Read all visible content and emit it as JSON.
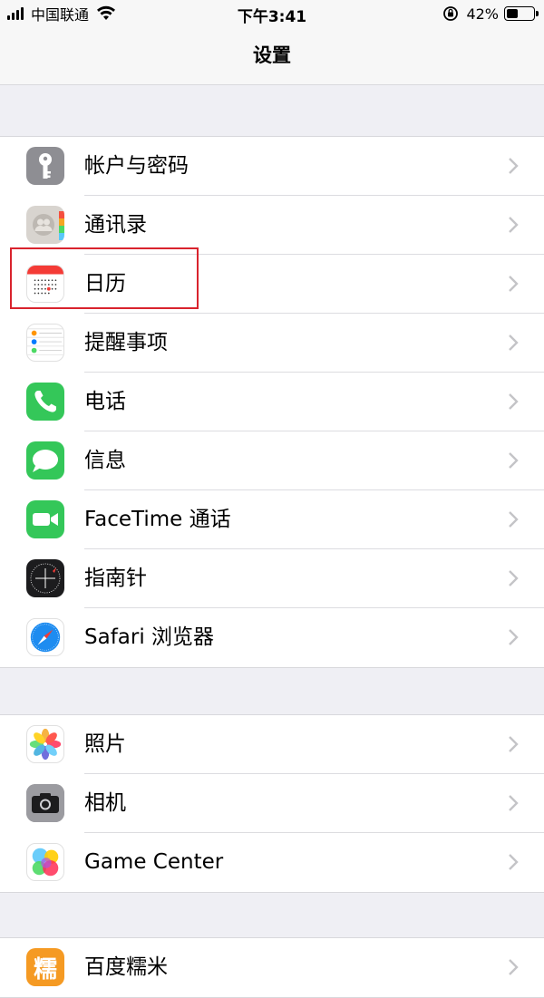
{
  "status_bar": {
    "carrier": "中国联通",
    "time": "下午3:41",
    "battery_percent": "42%",
    "battery_level": 0.42
  },
  "nav": {
    "title": "设置"
  },
  "groups": [
    {
      "items": [
        {
          "label": "帐户与密码",
          "icon": "key-icon",
          "color": "#8e8e93"
        },
        {
          "label": "通讯录",
          "icon": "contacts-icon",
          "color": "#d8d4cf"
        },
        {
          "label": "日历",
          "icon": "calendar-icon",
          "color": "#ffffff"
        },
        {
          "label": "提醒事项",
          "icon": "reminders-icon",
          "color": "#ffffff"
        },
        {
          "label": "电话",
          "icon": "phone-icon",
          "color": "#34c759"
        },
        {
          "label": "信息",
          "icon": "messages-icon",
          "color": "#34c759"
        },
        {
          "label": "FaceTime 通话",
          "icon": "facetime-icon",
          "color": "#34c759"
        },
        {
          "label": "指南针",
          "icon": "compass-icon",
          "color": "#1c1c1e"
        },
        {
          "label": "Safari 浏览器",
          "icon": "safari-icon",
          "color": "#ffffff"
        }
      ]
    },
    {
      "items": [
        {
          "label": "照片",
          "icon": "photos-icon",
          "color": "#ffffff"
        },
        {
          "label": "相机",
          "icon": "camera-icon",
          "color": "#8e8e93"
        },
        {
          "label": "Game Center",
          "icon": "game-center-icon",
          "color": "#ffffff"
        }
      ]
    },
    {
      "items": [
        {
          "label": "百度糯米",
          "icon": "baidu-nuomi-icon",
          "color": "#f59a23",
          "icon_glyph": "糯"
        }
      ]
    }
  ],
  "highlight": {
    "color": "#d9232d",
    "target": "日历"
  }
}
